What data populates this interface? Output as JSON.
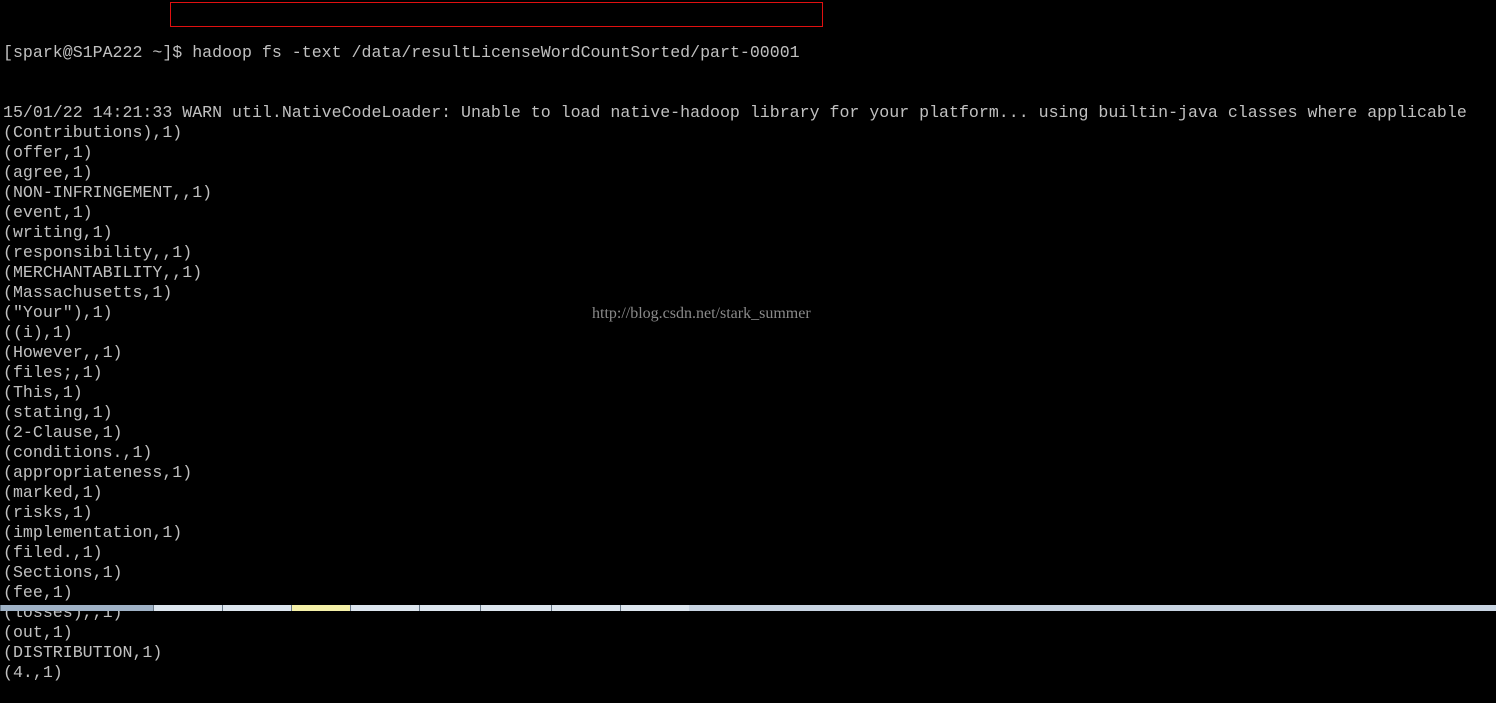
{
  "terminal": {
    "prompt": "[spark@S1PA222 ~]",
    "command": "$ hadoop fs -text /data/resultLicenseWordCountSorted/part-00001",
    "output": [
      "15/01/22 14:21:33 WARN util.NativeCodeLoader: Unable to load native-hadoop library for your platform... using builtin-java classes where applicable",
      "(Contributions),1)",
      "(offer,1)",
      "(agree,1)",
      "(NON-INFRINGEMENT,,1)",
      "(event,1)",
      "(writing,1)",
      "(responsibility,,1)",
      "(MERCHANTABILITY,,1)",
      "(Massachusetts,1)",
      "(\"Your\"),1)",
      "((i),1)",
      "(However,,1)",
      "(files;,1)",
      "(This,1)",
      "(stating,1)",
      "(2-Clause,1)",
      "(conditions.,1)",
      "(appropriateness,1)",
      "(marked,1)",
      "(risks,1)",
      "(implementation,1)",
      "(filed.,1)",
      "(Sections,1)",
      "(fee,1)",
      "(losses),,1)",
      "(out,1)",
      "(DISTRIBUTION,1)",
      "(4.,1)"
    ]
  },
  "watermark": "http://blog.csdn.net/stark_summer",
  "colors": {
    "background": "#000000",
    "text": "#c0c0c0",
    "highlight_box": "#e01010"
  }
}
